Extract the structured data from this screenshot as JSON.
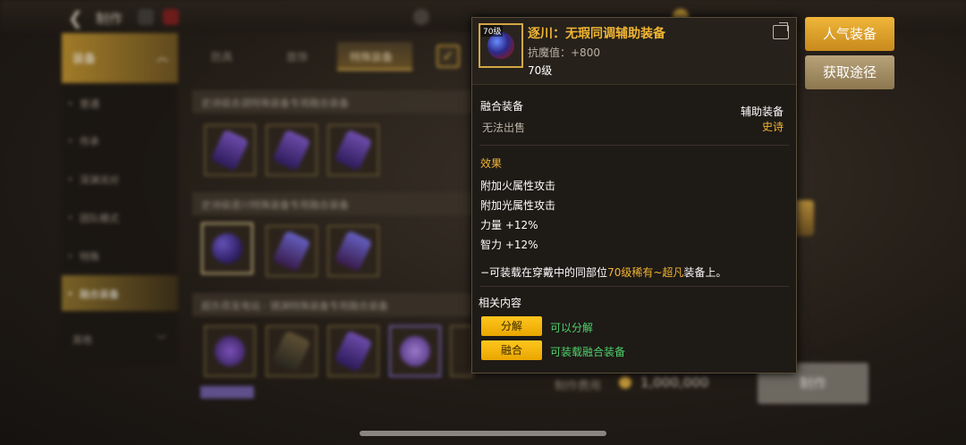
{
  "header": {
    "title": "制作"
  },
  "sidebar": {
    "top_label": "装备",
    "items": [
      {
        "label": "普通"
      },
      {
        "label": "传承"
      },
      {
        "label": "深渊派对"
      },
      {
        "label": "团队模式"
      },
      {
        "label": "特殊"
      },
      {
        "label": "融合装备"
      },
      {
        "label": "其他"
      }
    ]
  },
  "tabs": [
    {
      "label": "防具"
    },
    {
      "label": "首饰"
    },
    {
      "label": "特殊装备"
    }
  ],
  "sections": [
    {
      "title": "史诗级去调特殊装备专用融合装备"
    },
    {
      "title": "史诗级逐川特殊装备专用融合装备"
    },
    {
      "title": "超负荷发电站 - 镜渊特殊装备专用融合装备"
    }
  ],
  "right_buttons": {
    "popular": "人气装备",
    "obtain": "获取途径",
    "make": "制作"
  },
  "cost": {
    "label": "制作费用",
    "value": "1,000,000"
  },
  "tooltip": {
    "level_badge": "70级",
    "name": "逐川：无瑕同调辅助装备",
    "stat": "抗魔值：+800",
    "level": "70级",
    "type_label": "融合装备",
    "sell": "无法出售",
    "slot_label": "辅助装备",
    "rarity": "史诗",
    "effect_title": "效果",
    "effects": [
      "附加火属性攻击",
      "附加光属性攻击",
      "力量 +12%",
      "智力 +12%"
    ],
    "note_prefix": "−可装载在穿戴中的同部位",
    "note_highlight": "70级稀有~超凡",
    "note_suffix": "装备上。",
    "related_title": "相关内容",
    "actions": [
      {
        "button": "分解",
        "desc": "可以分解"
      },
      {
        "button": "融合",
        "desc": "可装载融合装备"
      }
    ]
  },
  "colors": {
    "gold": "#f1b534",
    "green": "#4fd26b",
    "accent": "#ffc61e"
  }
}
